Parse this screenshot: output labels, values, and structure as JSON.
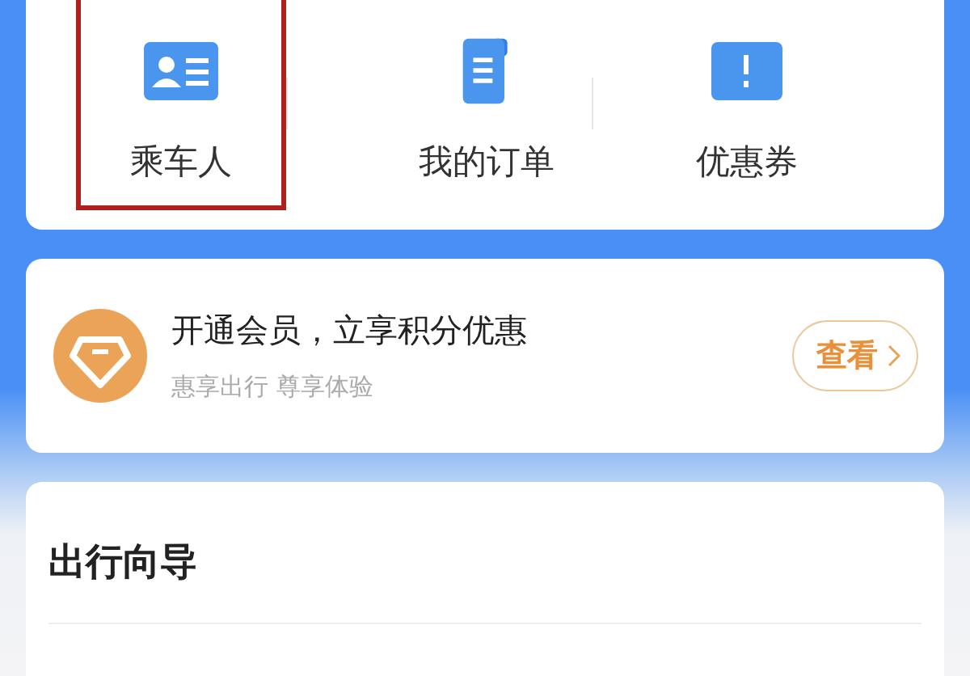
{
  "shortcuts": [
    {
      "kind": "id-card",
      "label": "乘车人",
      "highlighted": true
    },
    {
      "kind": "document",
      "label": "我的订单",
      "highlighted": false
    },
    {
      "kind": "ticket",
      "label": "优惠券",
      "highlighted": false
    }
  ],
  "membership": {
    "title": "开通会员，立享积分优惠",
    "subtitle": "惠享出行 尊享体验",
    "button": "查看"
  },
  "guide": {
    "title": "出行向导"
  }
}
